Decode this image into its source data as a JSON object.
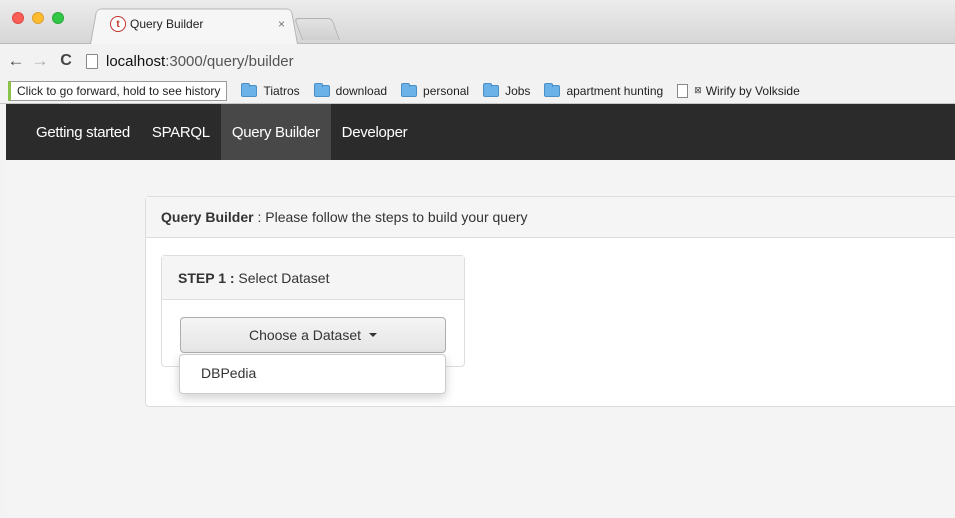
{
  "browser": {
    "tab_title": "Query Builder",
    "tab_close": "×",
    "url_host": "localhost",
    "url_path": ":3000/query/builder",
    "tooltip": "Click to go forward, hold to see history",
    "bookmarks": [
      {
        "label": "Tiatros",
        "icon": "folder-icon"
      },
      {
        "label": "download",
        "icon": "folder-icon"
      },
      {
        "label": "personal",
        "icon": "folder-icon"
      },
      {
        "label": "Jobs",
        "icon": "folder-icon"
      },
      {
        "label": "apartment hunting",
        "icon": "folder-icon"
      },
      {
        "label": "Wirify by Volkside",
        "icon": "page-icon"
      }
    ]
  },
  "navbar": {
    "items": [
      {
        "label": "Getting started"
      },
      {
        "label": "SPARQL"
      },
      {
        "label": "Query Builder",
        "active": true
      },
      {
        "label": "Developer"
      }
    ]
  },
  "main": {
    "heading_bold": "Query Builder",
    "heading_rest": " : Please follow the steps to build your query",
    "step": {
      "label_bold": "STEP 1 :",
      "label_rest": " Select Dataset",
      "dropdown_label": "Choose a Dataset",
      "options": [
        "DBPedia"
      ]
    }
  },
  "colors": {
    "navbar_bg": "#2b2b2b",
    "navbar_active": "#484848"
  }
}
